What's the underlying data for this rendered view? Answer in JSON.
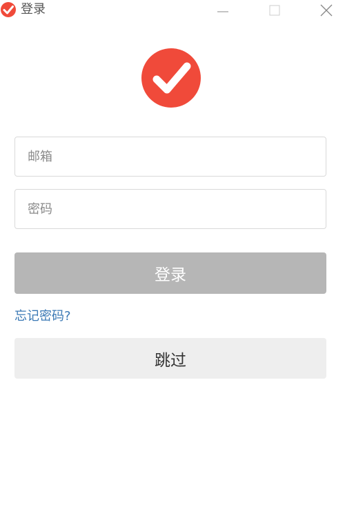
{
  "window": {
    "title": "登录",
    "icons": {
      "app": "check-circle-icon",
      "minimize": "minimize-icon",
      "maximize": "maximize-icon",
      "close": "close-icon"
    }
  },
  "logo": {
    "icon": "check-circle-logo",
    "color": "#f04a3a"
  },
  "form": {
    "email": {
      "placeholder": "邮箱",
      "value": ""
    },
    "password": {
      "placeholder": "密码",
      "value": ""
    },
    "login_label": "登录",
    "forgot_label": "忘记密码?",
    "skip_label": "跳过"
  },
  "colors": {
    "brand": "#f04a3a",
    "login_button_disabled": "#b6b6b6",
    "link": "#3a78b4",
    "skip_button": "#eeeeee"
  }
}
